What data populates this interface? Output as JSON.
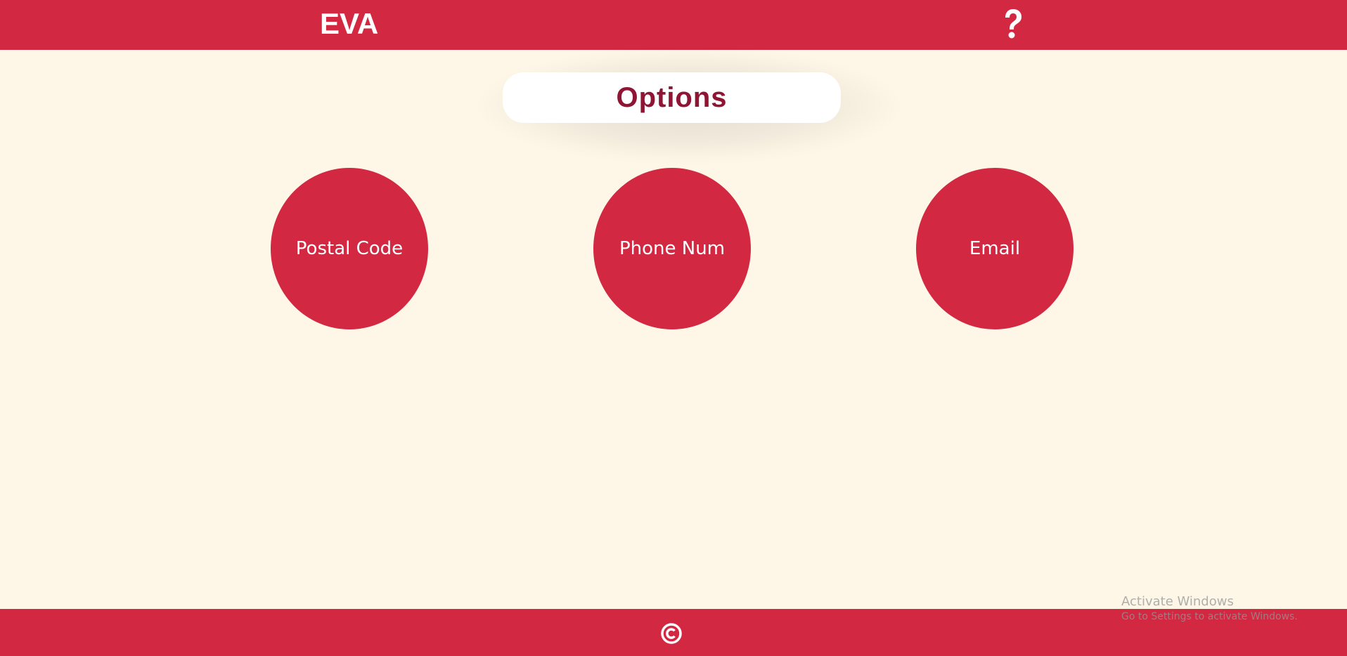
{
  "header": {
    "brand": "EVA",
    "help_icon": "question-mark-icon"
  },
  "main": {
    "title": "Options",
    "options": [
      {
        "label": "Postal Code"
      },
      {
        "label": "Phone Num"
      },
      {
        "label": "Email"
      }
    ]
  },
  "footer": {
    "icon": "copyright-icon"
  },
  "watermark": {
    "title": "Activate Windows",
    "subtitle": "Go to Settings to activate Windows."
  },
  "colors": {
    "primary": "#d32841",
    "background": "#fef7e8",
    "title_text": "#8e1533",
    "white": "#ffffff"
  }
}
